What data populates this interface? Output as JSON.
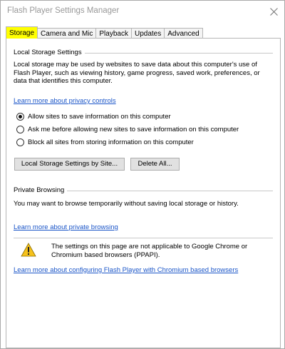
{
  "window": {
    "title": "Flash Player Settings Manager"
  },
  "tabs": [
    {
      "label": "Storage"
    },
    {
      "label": "Camera and Mic"
    },
    {
      "label": "Playback"
    },
    {
      "label": "Updates"
    },
    {
      "label": "Advanced"
    }
  ],
  "local_storage": {
    "heading": "Local Storage Settings",
    "description": "Local storage may be used by websites to save data about this computer's use of Flash Player, such as viewing history, game progress, saved work, preferences, or data that identifies this computer.",
    "privacy_link": "Learn more about privacy controls",
    "options": [
      {
        "label": "Allow sites to save information on this computer",
        "checked": true
      },
      {
        "label": "Ask me before allowing new sites to save information on this computer",
        "checked": false
      },
      {
        "label": "Block all sites from storing information on this computer",
        "checked": false
      }
    ],
    "by_site_button": "Local Storage Settings by Site...",
    "delete_all_button": "Delete All..."
  },
  "private_browsing": {
    "heading": "Private Browsing",
    "description": "You may want to browse temporarily without saving local storage or history.",
    "link": "Learn more about private browsing"
  },
  "notice": {
    "text": "The settings on this page are not applicable to Google Chrome or Chromium based browsers (PPAPI).",
    "link": "Learn more about configuring Flash Player with Chromium based browsers"
  },
  "colors": {
    "active_tab_highlight": "#ffff00",
    "link": "#1a55c8"
  }
}
